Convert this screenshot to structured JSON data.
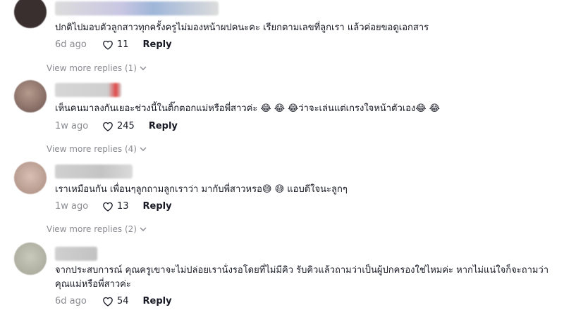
{
  "comments": [
    {
      "text": "ปกติไปมอบตัวลูกสาวทุกครั้งครูไม่มองหน้าผปคนะคะ เรียกตามเลขที่ลูกเรา แล้วค่อยขอดูเอกสาร",
      "date": "6d ago",
      "likes": "11",
      "reply": "Reply",
      "more": "View more replies (1)"
    },
    {
      "text": "เห็นคนมาลงกันเยอะช่วงนี้ในติ๊กตอกแม่หรือพี่สาวค่ะ 😂 😂 😂ว่าจะเล่นแต่เกรงใจหน้าตัวเอง😂 😂",
      "date": "1w ago",
      "likes": "245",
      "reply": "Reply",
      "more": "View more replies (4)"
    },
    {
      "text": "เราเหมือนกัน เพื่อนๆลูกถามลูกเราว่า มากับพี่สาวหรอ😅 😅 แอบดีใจนะลูกๆ",
      "date": "1w ago",
      "likes": "13",
      "reply": "Reply",
      "more": "View more replies (2)"
    },
    {
      "text": "จากประสบการณ์ คุณครูเขาจะไม่ปล่อยเราน้่งรอโดยที่ไม่มีคิว รับคิวแล้วถามว่าเป็นผู้ปกครองใช่ไหมค่ะ หากไม่แน่ใจก็จะถามว่าคุณแม่หรือพี่สาวค่ะ",
      "date": "6d ago",
      "likes": "54",
      "reply": "Reply"
    }
  ],
  "colors": {
    "text": "#161823",
    "muted": "#8a8b91"
  }
}
